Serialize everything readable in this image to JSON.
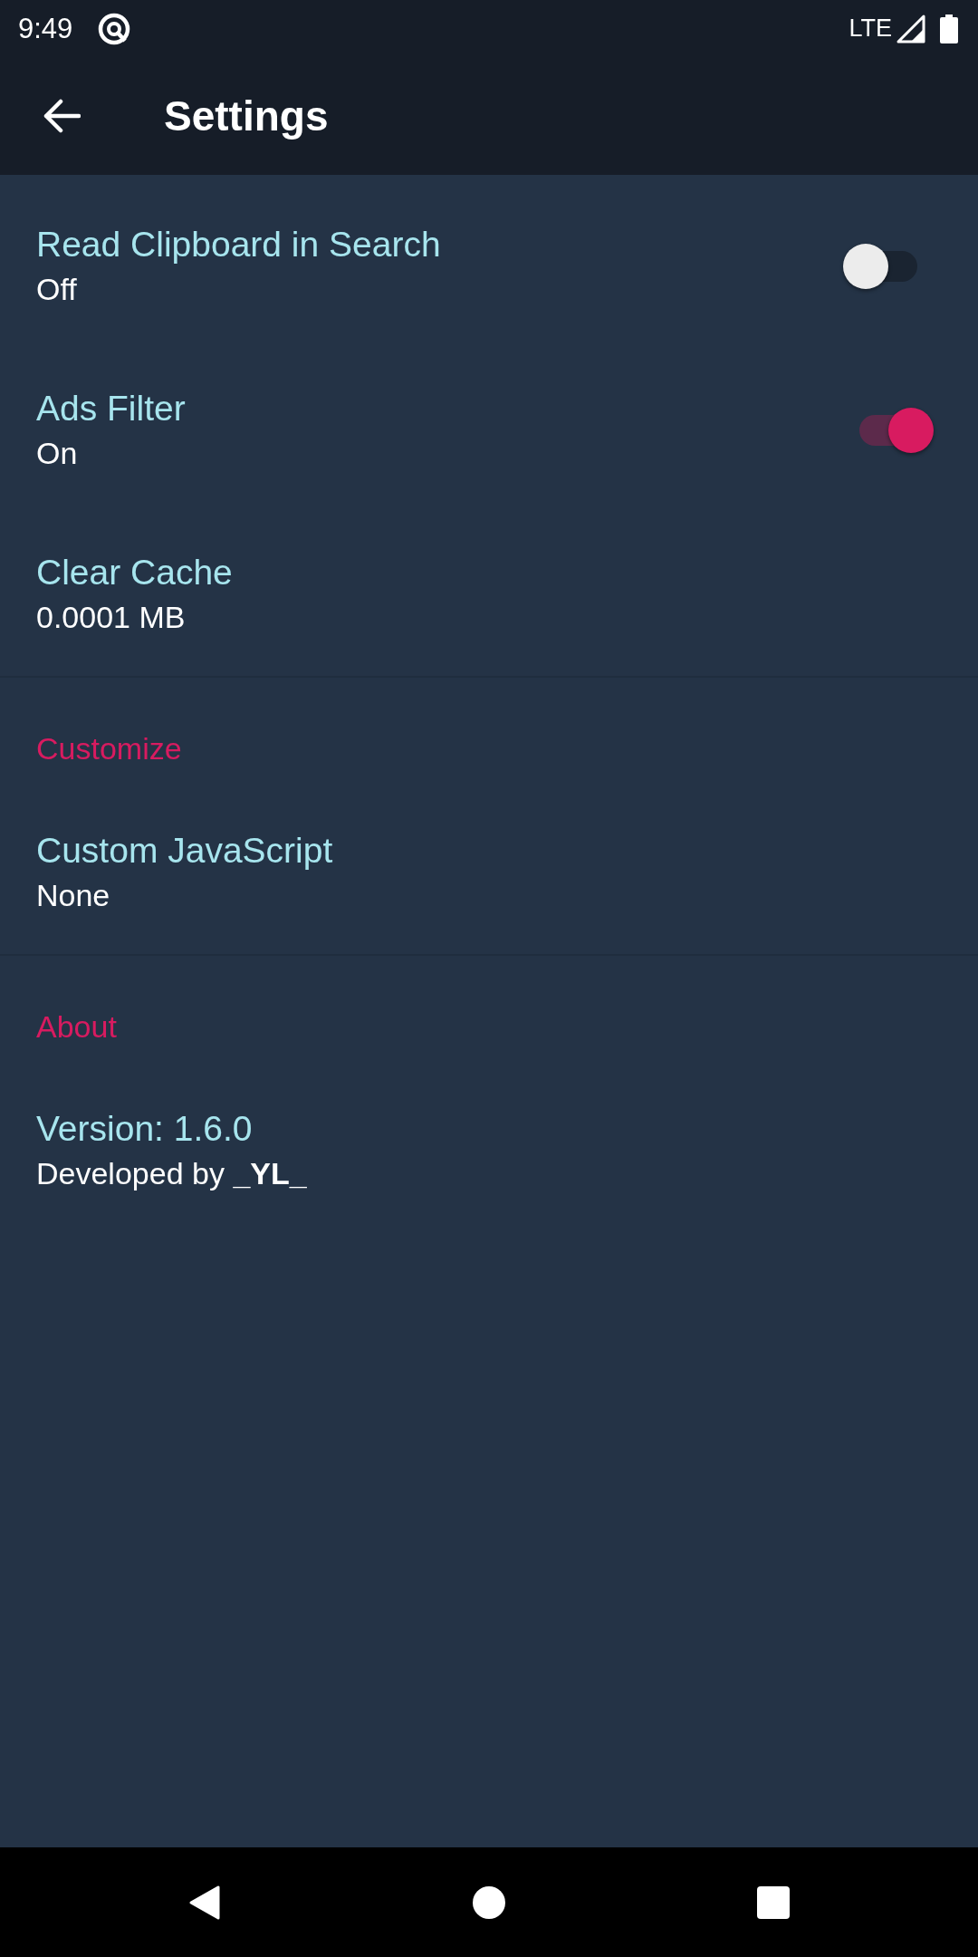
{
  "status_bar": {
    "time": "9:49",
    "network": "LTE"
  },
  "app_bar": {
    "title": "Settings"
  },
  "sections": [
    {
      "items": [
        {
          "kind": "switch",
          "title": "Read Clipboard in Search",
          "summary": "Off",
          "on": false
        },
        {
          "kind": "switch",
          "title": "Ads Filter",
          "summary": "On",
          "on": true
        },
        {
          "kind": "plain",
          "title": "Clear Cache",
          "summary": "0.0001 MB"
        }
      ]
    },
    {
      "header": "Customize",
      "items": [
        {
          "kind": "plain",
          "title": "Custom JavaScript",
          "summary": "None"
        }
      ]
    },
    {
      "header": "About",
      "items": [
        {
          "kind": "plain",
          "title": "Version: 1.6.0",
          "summary": "Developed by **_YL_**"
        }
      ]
    }
  ]
}
